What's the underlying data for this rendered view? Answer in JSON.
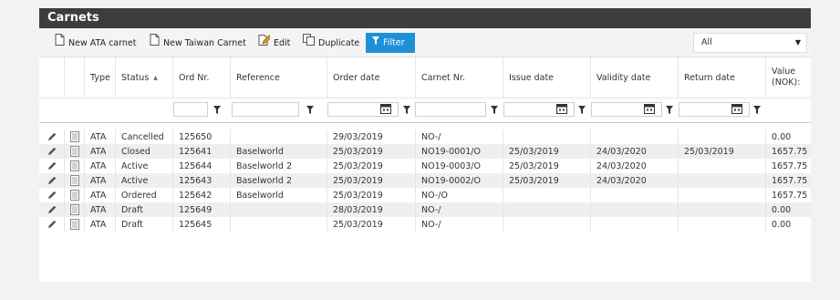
{
  "title": "Carnets",
  "toolbar": {
    "new_ata": "New ATA carnet",
    "new_taiwan": "New Taiwan Carnet",
    "edit": "Edit",
    "duplicate": "Duplicate",
    "filter": "Filter",
    "select_value": "All"
  },
  "columns": [
    "Type",
    "Status",
    "Ord Nr.",
    "Reference",
    "Order date",
    "Carnet Nr.",
    "Issue date",
    "Validity date",
    "Return date",
    "Value (NOK):"
  ],
  "sort_indicator": "▲",
  "rows": [
    {
      "type": "ATA",
      "status": "Cancelled",
      "ord": "125650",
      "ref": "",
      "order_date": "29/03/2019",
      "carnet": "NO-/",
      "issue": "",
      "validity": "",
      "return": "",
      "value": "0.00"
    },
    {
      "type": "ATA",
      "status": "Closed",
      "ord": "125641",
      "ref": "Baselworld",
      "order_date": "25/03/2019",
      "carnet": "NO19-0001/O",
      "issue": "25/03/2019",
      "validity": "24/03/2020",
      "return": "25/03/2019",
      "value": "1657.75"
    },
    {
      "type": "ATA",
      "status": "Active",
      "ord": "125644",
      "ref": "Baselworld 2",
      "order_date": "25/03/2019",
      "carnet": "NO19-0003/O",
      "issue": "25/03/2019",
      "validity": "24/03/2020",
      "return": "",
      "value": "1657.75"
    },
    {
      "type": "ATA",
      "status": "Active",
      "ord": "125643",
      "ref": "Baselworld 2",
      "order_date": "25/03/2019",
      "carnet": "NO19-0002/O",
      "issue": "25/03/2019",
      "validity": "24/03/2020",
      "return": "",
      "value": "1657.75"
    },
    {
      "type": "ATA",
      "status": "Ordered",
      "ord": "125642",
      "ref": "Baselworld",
      "order_date": "25/03/2019",
      "carnet": "NO-/O",
      "issue": "",
      "validity": "",
      "return": "",
      "value": "1657.75"
    },
    {
      "type": "ATA",
      "status": "Draft",
      "ord": "125649",
      "ref": "",
      "order_date": "28/03/2019",
      "carnet": "NO-/",
      "issue": "",
      "validity": "",
      "return": "",
      "value": "0.00"
    },
    {
      "type": "ATA",
      "status": "Draft",
      "ord": "125645",
      "ref": "",
      "order_date": "25/03/2019",
      "carnet": "NO-/",
      "issue": "",
      "validity": "",
      "return": "",
      "value": "0.00"
    }
  ],
  "icons": {
    "edit_row": "pencil-icon",
    "details_row": "document-icon",
    "filter": "funnel-icon",
    "calendar": "calendar-icon"
  },
  "colors": {
    "title_bg": "#3d3d3d",
    "filter_btn": "#1e90d6",
    "row_alt": "#efefef"
  }
}
